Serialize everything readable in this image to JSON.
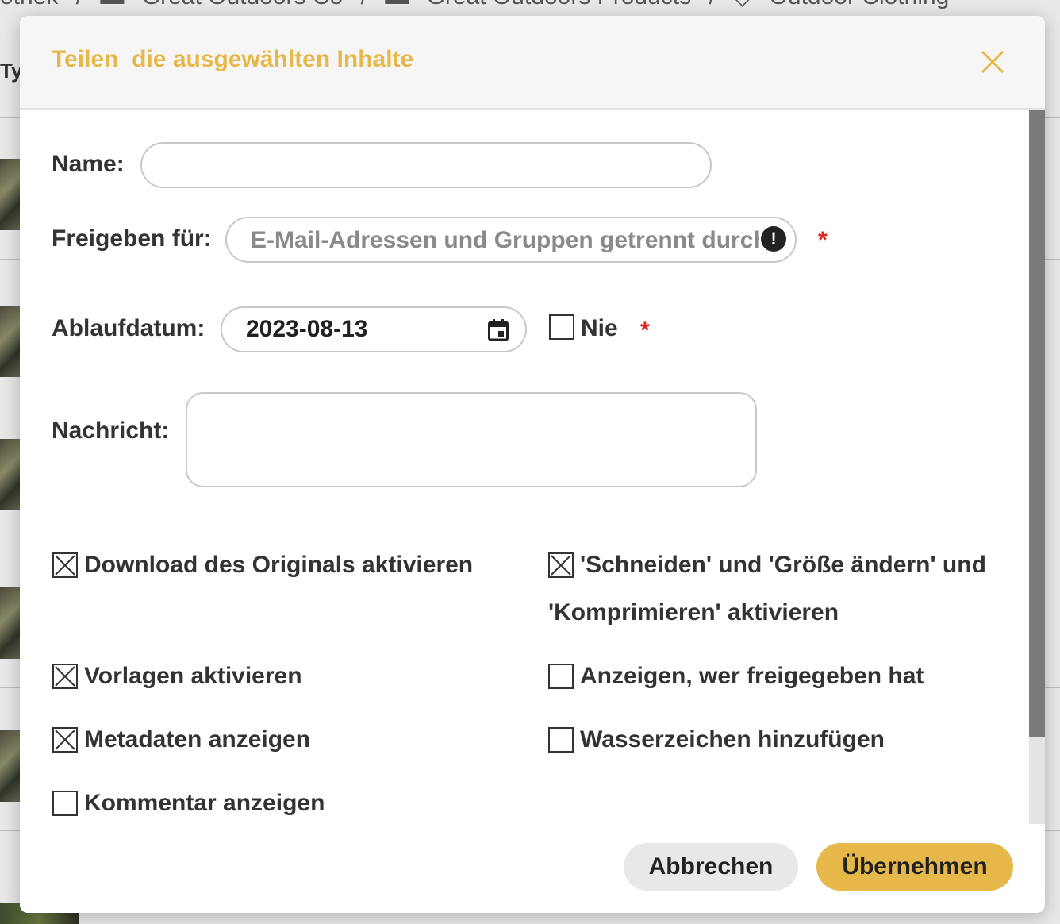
{
  "background": {
    "breadcrumb": [
      "otnek",
      "/",
      "Great Outdoors Co",
      "/",
      "Great Outdoors Products",
      "/",
      "Outdoor Clothing"
    ],
    "column_header": "Ty"
  },
  "dialog": {
    "title": "Teilen  die ausgewählten Inhalte",
    "fields": {
      "name_label": "Name:",
      "name_value": "",
      "share_label": "Freigeben für:",
      "share_placeholder": "E-Mail-Adressen und Gruppen getrennt durch Komma",
      "expiry_label": "Ablaufdatum:",
      "expiry_value": "2023-08-13",
      "never_label": "Nie",
      "message_label": "Nachricht:",
      "message_value": "",
      "required_marker": "*"
    },
    "options": [
      {
        "label": "Download des Originals aktivieren",
        "checked": true
      },
      {
        "label_line1": "'Schneiden' und 'Größe ändern' und",
        "label_line2": "'Komprimieren' aktivieren",
        "checked": true
      },
      {
        "label": "Vorlagen aktivieren",
        "checked": true
      },
      {
        "label": "Anzeigen, wer freigegeben hat",
        "checked": false
      },
      {
        "label": "Metadaten anzeigen",
        "checked": true
      },
      {
        "label": "Wasserzeichen hinzufügen",
        "checked": false
      },
      {
        "label": "Kommentar anzeigen",
        "checked": false
      }
    ],
    "never_checked": false,
    "buttons": {
      "cancel": "Abbrechen",
      "apply": "Übernehmen"
    },
    "colors": {
      "accent": "#e6b84a",
      "required": "#e02424",
      "cancel_bg": "#e8e8e8"
    },
    "icons": {
      "close": "close-icon",
      "info": "info-icon",
      "calendar": "calendar-icon",
      "checked": "checkbox-checked-icon"
    }
  }
}
